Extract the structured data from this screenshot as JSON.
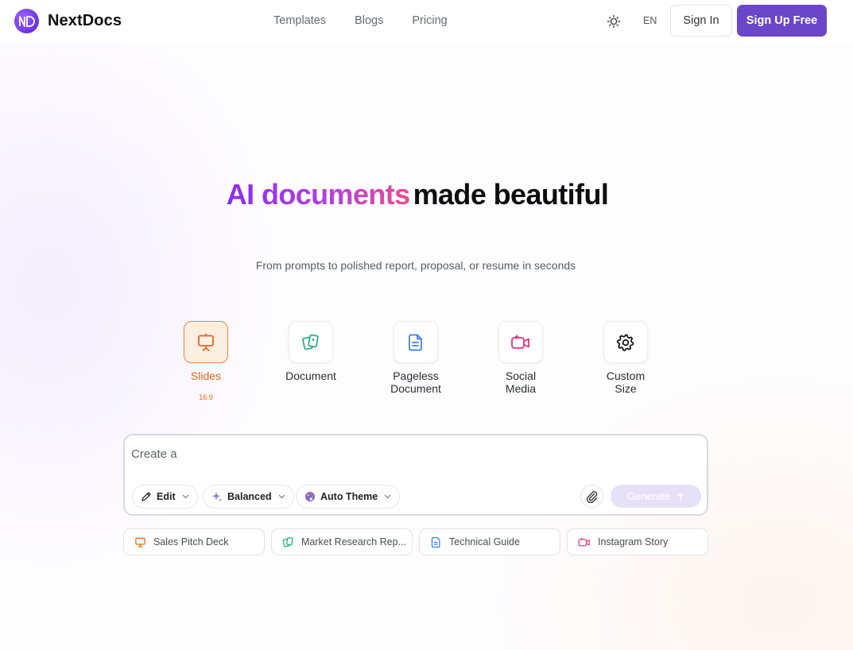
{
  "header": {
    "logo_text": "ND",
    "brand": "NextDocs",
    "nav": [
      "Templates",
      "Blogs",
      "Pricing"
    ],
    "lang": "EN",
    "sign_in": "Sign In",
    "sign_up": "Sign Up Free",
    "theme_icon": "sun-icon"
  },
  "hero": {
    "title_highlight": "AI documents",
    "title_rest": "made beautiful",
    "subtitle": "From prompts to polished report, proposal, or resume in seconds"
  },
  "formats": [
    {
      "label": "Slides",
      "icon": "presentation-icon",
      "ratio": "16:9",
      "active": true,
      "color": "#e8661b"
    },
    {
      "label": "Document",
      "icon": "document-cards-icon",
      "active": false,
      "color": "#1fae7a"
    },
    {
      "label": "Pageless\nDocument",
      "icon": "file-text-icon",
      "active": false,
      "color": "#3b7be8"
    },
    {
      "label": "Social\nMedia",
      "icon": "video-sparkle-icon",
      "active": false,
      "color": "#e0357f"
    },
    {
      "label": "Custom\nSize",
      "icon": "gear-icon",
      "active": false,
      "color": "#111111"
    }
  ],
  "prompt": {
    "placeholder": "Create a",
    "chips": [
      "Edit",
      "Balanced",
      "Auto Theme"
    ],
    "generate": "Generate"
  },
  "suggestions": [
    {
      "label": "Sales Pitch Deck",
      "icon": "presentation-icon",
      "color": "#e8661b"
    },
    {
      "label": "Market Research Rep...",
      "icon": "document-cards-icon",
      "color": "#1fae7a"
    },
    {
      "label": "Technical Guide",
      "icon": "file-text-icon",
      "color": "#3b7be8"
    },
    {
      "label": "Instagram Story",
      "icon": "video-sparkle-icon",
      "color": "#e0357f"
    }
  ],
  "colors": {
    "brand": "#6b46c9",
    "accent_orange": "#e8661b",
    "title_gradient": [
      "#8a2cf0",
      "#ee4a8c"
    ]
  }
}
